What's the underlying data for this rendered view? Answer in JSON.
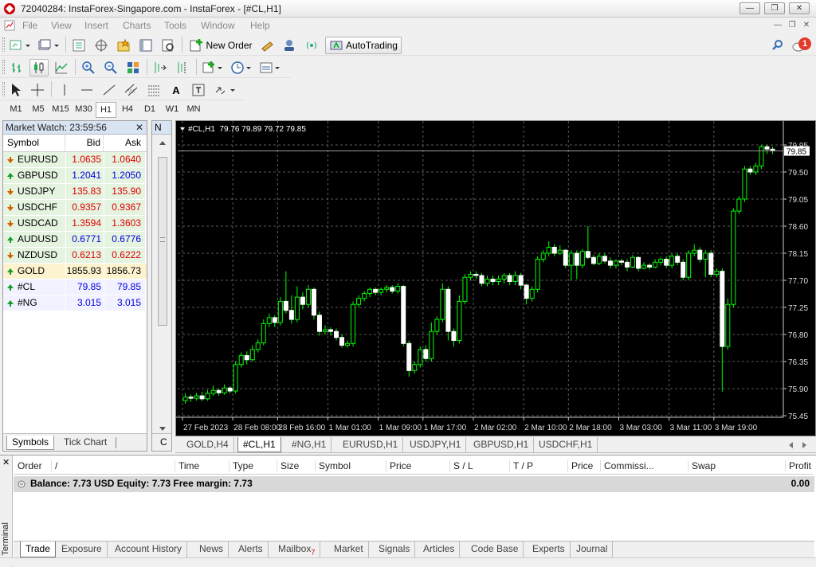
{
  "window": {
    "title": "72040284: InstaForex-Singapore.com - InstaForex - [#CL,H1]"
  },
  "menu": [
    "File",
    "View",
    "Insert",
    "Charts",
    "Tools",
    "Window",
    "Help"
  ],
  "toolbar": {
    "new_order_label": "New Order",
    "autotrading_label": "AutoTrading",
    "notification_count": "1"
  },
  "drawing_tools": {
    "text_tool": "A"
  },
  "timeframes": [
    "M1",
    "M5",
    "M15",
    "M30",
    "H1",
    "H4",
    "D1",
    "W1",
    "MN"
  ],
  "active_timeframe": "H1",
  "market_watch": {
    "header": "Market Watch: 23:59:56",
    "columns": {
      "symbol": "Symbol",
      "bid": "Bid",
      "ask": "Ask"
    },
    "rows": [
      {
        "symbol": "EURUSD",
        "bid": "1.0635",
        "ask": "1.0640",
        "dir": "down",
        "bg": "#ffffff",
        "color": "#e00000"
      },
      {
        "symbol": "GBPUSD",
        "bid": "1.2041",
        "ask": "1.2050",
        "dir": "up",
        "bg": "#ffffff",
        "color": "#0000e0"
      },
      {
        "symbol": "USDJPY",
        "bid": "135.83",
        "ask": "135.90",
        "dir": "down",
        "bg": "#ffffff",
        "color": "#e00000"
      },
      {
        "symbol": "USDCHF",
        "bid": "0.9357",
        "ask": "0.9367",
        "dir": "down",
        "bg": "#ffffff",
        "color": "#e00000"
      },
      {
        "symbol": "USDCAD",
        "bid": "1.3594",
        "ask": "1.3603",
        "dir": "down",
        "bg": "#ffffff",
        "color": "#e00000"
      },
      {
        "symbol": "AUDUSD",
        "bid": "0.6771",
        "ask": "0.6776",
        "dir": "up",
        "bg": "#ffffff",
        "color": "#0000e0"
      },
      {
        "symbol": "NZDUSD",
        "bid": "0.6213",
        "ask": "0.6222",
        "dir": "down",
        "bg": "#ffffff",
        "color": "#e00000"
      },
      {
        "symbol": "GOLD",
        "bid": "1855.93",
        "ask": "1856.73",
        "dir": "up",
        "bg": "#fdf3cf",
        "color": "#000000"
      },
      {
        "symbol": "#CL",
        "bid": "79.85",
        "ask": "79.85",
        "dir": "up",
        "bg": "#ffffff",
        "color": "#0000e0"
      },
      {
        "symbol": "#NG",
        "bid": "3.015",
        "ask": "3.015",
        "dir": "up",
        "bg": "#ffffff",
        "color": "#0000e0"
      }
    ],
    "tabs": [
      "Symbols",
      "Tick Chart"
    ]
  },
  "navigator": {
    "header_letter": "N",
    "bottom_letter": "C"
  },
  "chart": {
    "header": "#CL,H1  79.76 79.89 79.72 79.85",
    "current_price": "79.85",
    "bg": "#000000",
    "bull_color": "#00ff00",
    "bear_color": "#ffffff",
    "price_levels": [
      "79.95",
      "79.50",
      "79.05",
      "78.60",
      "78.15",
      "77.70",
      "77.25",
      "76.80",
      "76.35",
      "75.90",
      "75.45"
    ],
    "time_labels": [
      "27 Feb 2023",
      "28 Feb 08:00",
      "28 Feb 16:00",
      "1 Mar 01:00",
      "1 Mar 09:00",
      "1 Mar 17:00",
      "2 Mar 02:00",
      "2 Mar 10:00",
      "2 Mar 18:00",
      "3 Mar 03:00",
      "3 Mar 11:00",
      "3 Mar 19:00"
    ]
  },
  "chart_data": {
    "type": "candlestick",
    "title": "#CL,H1",
    "ylim": [
      75.45,
      79.95
    ],
    "candles": [
      [
        75.7,
        75.76,
        75.82,
        75.65
      ],
      [
        75.76,
        75.74,
        75.8,
        75.68
      ],
      [
        75.74,
        75.78,
        75.83,
        75.7
      ],
      [
        75.78,
        75.73,
        75.85,
        75.69
      ],
      [
        75.73,
        75.82,
        75.88,
        75.7
      ],
      [
        75.82,
        75.87,
        75.95,
        75.78
      ],
      [
        75.87,
        75.83,
        75.9,
        75.78
      ],
      [
        75.83,
        75.91,
        75.97,
        75.8
      ],
      [
        75.91,
        75.86,
        75.94,
        75.82
      ],
      [
        75.86,
        76.3,
        76.35,
        75.82
      ],
      [
        76.3,
        76.45,
        76.5,
        76.25
      ],
      [
        76.45,
        76.38,
        76.52,
        76.3
      ],
      [
        76.38,
        76.55,
        76.62,
        76.35
      ],
      [
        76.55,
        76.66,
        76.72,
        76.5
      ],
      [
        76.66,
        76.98,
        77.05,
        76.62
      ],
      [
        76.98,
        77.08,
        77.15,
        76.92
      ],
      [
        77.08,
        77.0,
        77.12,
        76.92
      ],
      [
        77.0,
        77.35,
        77.42,
        76.95
      ],
      [
        77.35,
        77.2,
        77.85,
        77.15
      ],
      [
        77.2,
        77.05,
        77.45,
        76.98
      ],
      [
        77.05,
        77.42,
        77.6,
        77.0
      ],
      [
        77.42,
        77.3,
        77.5,
        77.22
      ],
      [
        77.3,
        77.55,
        77.62,
        77.25
      ],
      [
        77.55,
        77.12,
        77.58,
        77.05
      ],
      [
        77.12,
        76.85,
        77.18,
        76.78
      ],
      [
        76.85,
        76.88,
        76.95,
        76.8
      ],
      [
        76.88,
        76.85,
        76.92,
        76.78
      ],
      [
        76.85,
        76.75,
        76.9,
        76.7
      ],
      [
        76.75,
        76.62,
        76.8,
        76.58
      ],
      [
        76.62,
        76.65,
        76.7,
        76.58
      ],
      [
        76.65,
        77.3,
        77.35,
        76.6
      ],
      [
        77.3,
        77.4,
        77.45,
        77.25
      ],
      [
        77.4,
        77.48,
        77.52,
        77.35
      ],
      [
        77.48,
        77.55,
        77.58,
        77.42
      ],
      [
        77.55,
        77.5,
        77.58,
        77.45
      ],
      [
        77.5,
        77.55,
        77.58,
        77.45
      ],
      [
        77.55,
        77.58,
        77.62,
        77.5
      ],
      [
        77.58,
        77.52,
        77.62,
        77.48
      ],
      [
        77.52,
        77.6,
        77.65,
        77.48
      ],
      [
        77.6,
        76.65,
        77.62,
        76.6
      ],
      [
        76.65,
        76.2,
        76.7,
        76.1
      ],
      [
        76.2,
        76.3,
        76.35,
        76.15
      ],
      [
        76.3,
        76.55,
        76.6,
        76.25
      ],
      [
        76.55,
        76.4,
        76.62,
        76.35
      ],
      [
        76.4,
        76.85,
        77.0,
        76.35
      ],
      [
        76.85,
        77.05,
        77.1,
        76.8
      ],
      [
        77.05,
        77.55,
        77.65,
        77.0
      ],
      [
        77.55,
        76.85,
        77.6,
        76.7
      ],
      [
        76.85,
        76.7,
        76.9,
        76.6
      ],
      [
        76.7,
        77.35,
        77.45,
        76.65
      ],
      [
        77.35,
        77.75,
        77.8,
        77.3
      ],
      [
        77.75,
        77.8,
        77.85,
        77.7
      ],
      [
        77.8,
        77.78,
        77.85,
        77.72
      ],
      [
        77.78,
        77.65,
        77.82,
        77.6
      ],
      [
        77.65,
        77.72,
        77.78,
        77.6
      ],
      [
        77.72,
        77.68,
        77.78,
        77.62
      ],
      [
        77.68,
        77.72,
        77.78,
        77.62
      ],
      [
        77.72,
        77.78,
        77.82,
        77.65
      ],
      [
        77.78,
        77.68,
        77.82,
        77.62
      ],
      [
        77.68,
        77.78,
        77.85,
        77.62
      ],
      [
        77.78,
        77.62,
        77.82,
        77.55
      ],
      [
        77.62,
        77.4,
        77.65,
        77.3
      ],
      [
        77.4,
        77.55,
        77.6,
        77.35
      ],
      [
        77.55,
        78.05,
        78.1,
        77.5
      ],
      [
        78.05,
        78.15,
        78.2,
        78.0
      ],
      [
        78.15,
        78.25,
        78.35,
        78.1
      ],
      [
        78.25,
        78.15,
        78.3,
        78.1
      ],
      [
        78.15,
        78.2,
        78.28,
        78.12
      ],
      [
        78.2,
        77.95,
        78.22,
        77.9
      ],
      [
        77.95,
        78.15,
        78.2,
        77.7
      ],
      [
        78.15,
        77.95,
        78.2,
        77.72
      ],
      [
        77.95,
        78.18,
        78.22,
        77.9
      ],
      [
        78.18,
        78.08,
        78.6,
        78.05
      ],
      [
        78.08,
        77.98,
        78.12,
        77.95
      ],
      [
        77.98,
        78.1,
        78.15,
        77.95
      ],
      [
        78.1,
        78.02,
        78.15,
        77.98
      ],
      [
        78.02,
        77.95,
        78.08,
        77.9
      ],
      [
        77.95,
        78.02,
        78.05,
        77.9
      ],
      [
        78.02,
        78.0,
        78.06,
        77.95
      ],
      [
        78.0,
        77.92,
        78.05,
        77.85
      ],
      [
        77.92,
        78.08,
        78.12,
        77.9
      ],
      [
        78.08,
        77.9,
        78.1,
        77.85
      ],
      [
        77.9,
        77.95,
        78.0,
        77.88
      ],
      [
        77.95,
        77.92,
        77.98,
        77.88
      ],
      [
        77.92,
        78.0,
        78.05,
        77.9
      ],
      [
        78.0,
        78.05,
        78.08,
        77.95
      ],
      [
        78.05,
        77.95,
        78.1,
        77.9
      ],
      [
        77.95,
        78.1,
        78.15,
        77.9
      ],
      [
        78.1,
        78.0,
        78.15,
        77.95
      ],
      [
        78.0,
        77.75,
        78.05,
        77.7
      ],
      [
        77.75,
        78.15,
        78.2,
        77.7
      ],
      [
        78.15,
        78.2,
        78.3,
        78.1
      ],
      [
        78.2,
        78.05,
        78.25,
        78.0
      ],
      [
        78.05,
        78.15,
        78.2,
        77.75
      ],
      [
        78.15,
        77.8,
        78.2,
        77.75
      ],
      [
        77.8,
        77.85,
        77.9,
        77.75
      ],
      [
        77.85,
        76.6,
        77.9,
        75.85
      ],
      [
        76.6,
        77.3,
        77.4,
        76.55
      ],
      [
        77.3,
        78.85,
        78.9,
        77.25
      ],
      [
        78.85,
        79.05,
        79.1,
        78.8
      ],
      [
        79.05,
        79.55,
        79.6,
        79.0
      ],
      [
        79.55,
        79.5,
        79.6,
        79.45
      ],
      [
        79.5,
        79.6,
        79.65,
        79.45
      ],
      [
        79.6,
        79.92,
        79.95,
        79.55
      ],
      [
        79.92,
        79.88,
        79.95,
        79.8
      ],
      [
        79.88,
        79.85,
        79.92,
        79.8
      ]
    ]
  },
  "chart_tabs": [
    "GOLD,H4",
    "#CL,H1",
    "#NG,H1",
    "EURUSD,H1",
    "USDJPY,H1",
    "GBPUSD,H1",
    "USDCHF,H1"
  ],
  "active_chart_tab": "#CL,H1",
  "terminal": {
    "side_label": "Terminal",
    "columns": [
      "Order",
      "/",
      "Time",
      "Type",
      "Size",
      "Symbol",
      "Price",
      "S / L",
      "T / P",
      "Price",
      "Commissi...",
      "Swap",
      "Profit"
    ],
    "balance_text": "Balance: 7.73 USD  Equity: 7.73  Free margin: 7.73",
    "balance_profit": "0.00",
    "tabs": [
      "Trade",
      "Exposure",
      "Account History",
      "News",
      "Alerts",
      "Mailbox",
      "Market",
      "Signals",
      "Articles",
      "Code Base",
      "Experts",
      "Journal"
    ],
    "mailbox_count": "7"
  }
}
